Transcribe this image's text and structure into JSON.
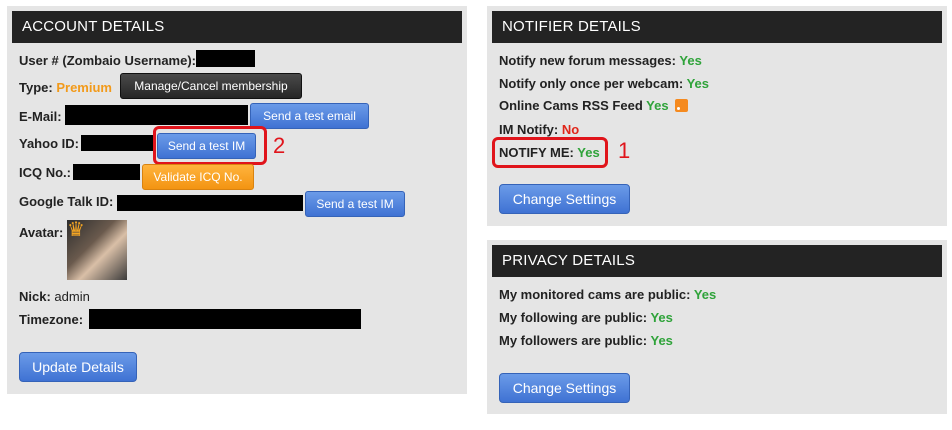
{
  "account": {
    "title": "ACCOUNT DETAILS",
    "user_label": "User # (Zombaio Username):",
    "type_label": "Type:",
    "type_value": "Premium",
    "manage_btn": "Manage/Cancel membership",
    "email_label": "E-Mail:",
    "test_email_btn": "Send a test email",
    "yahoo_label": "Yahoo ID:",
    "yahoo_btn": "Send a test IM",
    "icq_label": "ICQ No.:",
    "icq_btn": "Validate ICQ No.",
    "gtalk_label": "Google Talk ID:",
    "gtalk_btn": "Send a test IM",
    "avatar_label": "Avatar:",
    "nick_label": "Nick:",
    "nick_value": "admin",
    "timezone_label": "Timezone:",
    "update_btn": "Update Details",
    "annotation_number": "2"
  },
  "notifier": {
    "title": "NOTIFIER DETAILS",
    "forum_label": "Notify new forum messages:",
    "forum_value": "Yes",
    "once_label": "Notify only once per webcam:",
    "once_value": "Yes",
    "rss_label": "Online Cams RSS Feed",
    "rss_value": "Yes",
    "im_label": "IM Notify:",
    "im_value": "No",
    "notifyme_label": "NOTIFY ME:",
    "notifyme_value": "Yes",
    "change_btn": "Change Settings",
    "annotation_number": "1"
  },
  "privacy": {
    "title": "PRIVACY DETAILS",
    "monitored_label": "My monitored cams are public:",
    "monitored_value": "Yes",
    "following_label": "My following are public:",
    "following_value": "Yes",
    "followers_label": "My followers are public:",
    "followers_value": "Yes",
    "change_btn": "Change Settings"
  },
  "icons": [
    "crown-icon",
    "rss-icon"
  ],
  "colors": {
    "yes": "#2fa33a",
    "no": "#e0261a",
    "premium": "#f29a1a",
    "highlight": "#e0141b",
    "header": "#232323",
    "button_blue": "#3f72d3"
  }
}
